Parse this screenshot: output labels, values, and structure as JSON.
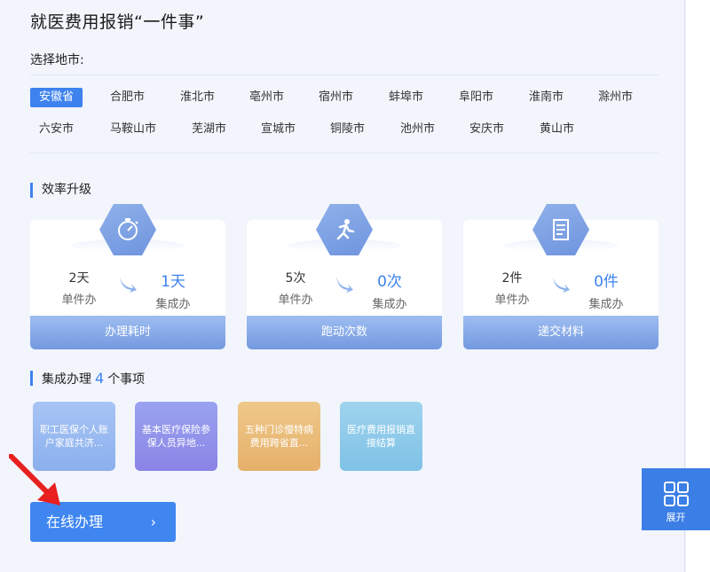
{
  "title": "就医费用报销“一件事”",
  "city_label": "选择地市:",
  "cities_row1": [
    "安徽省",
    "合肥市",
    "淮北市",
    "亳州市",
    "宿州市",
    "蚌埠市",
    "阜阳市",
    "淮南市",
    "滁州市"
  ],
  "cities_row2": [
    "六安市",
    "马鞍山市",
    "芜湖市",
    "宣城市",
    "铜陵市",
    "池州市",
    "安庆市",
    "黄山市"
  ],
  "selected_city": "安徽省",
  "efficiency_heading": "效率升级",
  "cards": [
    {
      "icon": "stopwatch-icon",
      "before_value": "2天",
      "before_label": "单件办",
      "after_value": "1天",
      "after_label": "集成办",
      "footer": "办理耗时"
    },
    {
      "icon": "running-person-icon",
      "before_value": "5次",
      "before_label": "单件办",
      "after_value": "0次",
      "after_label": "集成办",
      "footer": "跑动次数"
    },
    {
      "icon": "document-icon",
      "before_value": "2件",
      "before_label": "单件办",
      "after_value": "0件",
      "after_label": "集成办",
      "footer": "递交材料"
    }
  ],
  "integrated": {
    "prefix": "集成办理",
    "count": "4",
    "suffix": "个事项"
  },
  "tiles": [
    {
      "text": "职工医保个人账户家庭共济...",
      "color_from": "#a8c4f4",
      "color_to": "#8bb0ee"
    },
    {
      "text": "基本医疗保险参保人员异地...",
      "color_from": "#9aa3f0",
      "color_to": "#8a84e6"
    },
    {
      "text": "五种门诊慢特病费用跨省直...",
      "color_from": "#efc88a",
      "color_to": "#e5b06a"
    },
    {
      "text": "医疗费用报销直接结算",
      "color_from": "#9fd3ee",
      "color_to": "#7fc2e6"
    }
  ],
  "online_button": {
    "label": "在线办理",
    "chevron": "›"
  },
  "expand_button": {
    "label": "展开",
    "icon": "grid-icon"
  },
  "colors": {
    "accent": "#3d82ee",
    "annotation_arrow": "#e8201f"
  }
}
